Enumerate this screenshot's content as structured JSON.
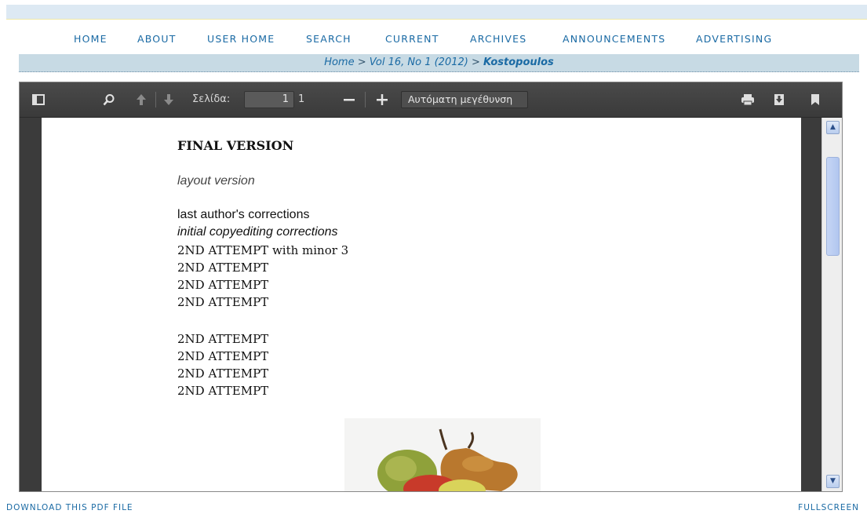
{
  "nav": {
    "items": [
      "HOME",
      "ABOUT",
      "USER HOME",
      "SEARCH",
      "CURRENT",
      "ARCHIVES",
      "ANNOUNCEMENTS",
      "ADVERTISING"
    ]
  },
  "breadcrumb": {
    "home": "Home",
    "sep1": " > ",
    "issue": "Vol 16, No 1 (2012)",
    "sep2": " > ",
    "article": "Kostopoulos"
  },
  "viewer": {
    "page_label": "Σελίδα:",
    "page_value": "1",
    "page_total": "1",
    "zoom_value": "Αυτόματη μεγέθυνση",
    "icons": {
      "sidebar": "sidebar-toggle-icon",
      "search": "search-icon",
      "prev": "previous-page-icon",
      "next": "next-page-icon",
      "zoom_out": "zoom-out-icon",
      "zoom_in": "zoom-in-icon",
      "print": "print-icon",
      "download": "download-icon",
      "bookmark": "bookmark-icon"
    }
  },
  "document": {
    "title": "FINAL VERSION",
    "subtitle": "layout version",
    "lines": [
      "last author's corrections",
      "initial copyediting corrections",
      "2ND ATTEMPT with minor 3",
      "2ND ATTEMPT",
      "2ND ATTEMPT",
      "2ND ATTEMPT",
      "2ND ATTEMPT",
      "2ND ATTEMPT",
      "2ND ATTEMPT",
      "2ND ATTEMPT"
    ]
  },
  "footer": {
    "download": "DOWNLOAD THIS PDF FILE",
    "fullscreen": "FULLSCREEN"
  },
  "colors": {
    "link": "#1a6aa4",
    "breadcrumb_bg": "#c7dae4",
    "viewer_bg": "#3c3c3c"
  }
}
